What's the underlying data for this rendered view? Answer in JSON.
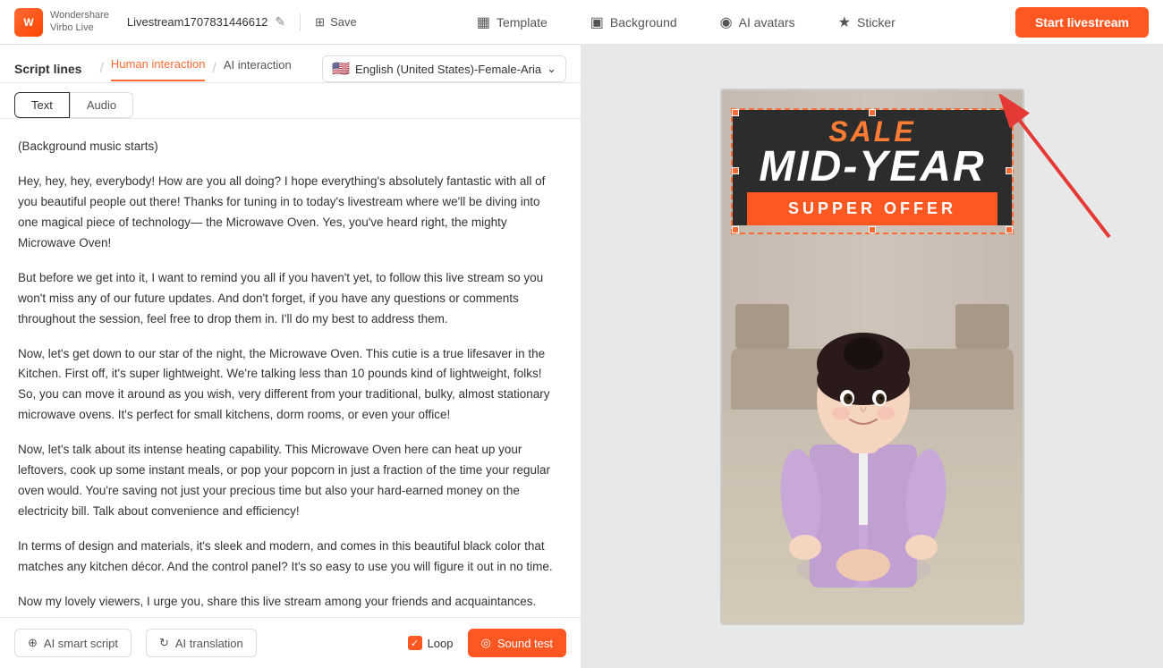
{
  "app": {
    "logo_line1": "Wondershare",
    "logo_line2": "Virbo Live",
    "stream_name": "Livestream1707831446612",
    "save_label": "Save"
  },
  "topnav": {
    "template_label": "Template",
    "background_label": "Background",
    "ai_avatars_label": "AI avatars",
    "sticker_label": "Sticker",
    "start_label": "Start livestream"
  },
  "script_panel": {
    "title": "Script lines",
    "human_interaction": "Human interaction",
    "ai_interaction": "AI interaction",
    "language_label": "English (United States)-Female-Aria",
    "tab_text": "Text",
    "tab_audio": "Audio",
    "paragraphs": [
      "(Background music starts)",
      "Hey, hey, hey, everybody! How are you all doing? I hope everything's absolutely fantastic with all of you beautiful people out there! Thanks for tuning in to today's livestream where we'll be diving into one magical piece of technology— the Microwave Oven. Yes, you've heard right, the mighty Microwave Oven!",
      "But before we get into it, I want to remind you all if you haven't yet, to follow this live stream so you won't miss any of our future updates. And don't forget, if you have any questions or comments throughout the session, feel free to drop them in. I'll do my best to address them.",
      "Now, let's get down to our star of the night, the Microwave Oven. This cutie is a true lifesaver in the Kitchen. First off, it's super lightweight. We're talking less than 10 pounds kind of lightweight, folks! So, you can move it around as you wish, very different from your traditional, bulky, almost stationary microwave ovens. It's perfect for small kitchens, dorm rooms, or even your office!",
      "Now, let's talk about its intense heating capability. This Microwave Oven here can heat up your leftovers, cook up some instant meals, or pop your popcorn in just a fraction of the time your regular oven would. You're saving not just your precious time but also your hard-earned money on the electricity bill. Talk about convenience and efficiency!",
      "In terms of design and materials, it's sleek and modern, and comes in this beautiful black color that matches any kitchen décor. And the control panel? It's so easy to use you will figure it out in no time.",
      "Now my lovely viewers, I urge you, share this live stream among your friends and acquaintances."
    ],
    "ai_smart_script": "AI smart script",
    "ai_translation": "AI translation",
    "loop_label": "Loop",
    "sound_test": "Sound test"
  },
  "banner": {
    "sale": "SALE",
    "midyear": "MID-YEAR",
    "supper": "SUPPER OFFER"
  },
  "icons": {
    "edit": "✎",
    "save": "⊞",
    "template": "▦",
    "background": "▣",
    "ai_avatar": "◉",
    "sticker": "★",
    "ai_script": "⊕",
    "ai_trans": "↻",
    "sound": "◎",
    "check": "✓",
    "flag": "🇺🇸"
  }
}
